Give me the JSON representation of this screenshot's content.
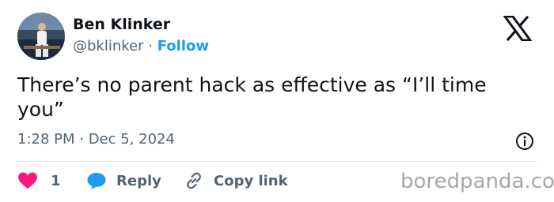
{
  "author": {
    "display_name": "Ben Klinker",
    "handle": "@bklinker",
    "separator": "·",
    "follow_label": "Follow"
  },
  "tweet": {
    "text": "There’s no parent hack as effective as “I’ll time you”",
    "timestamp": "1:28 PM · Dec 5, 2024"
  },
  "actions": {
    "like_count": "1",
    "reply_label": "Reply",
    "copy_link_label": "Copy link"
  },
  "watermark": "boredpanda.com",
  "colors": {
    "link_blue": "#1d9bf0",
    "like_red": "#f91880",
    "muted_gray": "#536471"
  },
  "icons": [
    "x-logo-icon",
    "info-icon",
    "heart-icon",
    "reply-bubble-icon",
    "link-icon"
  ]
}
